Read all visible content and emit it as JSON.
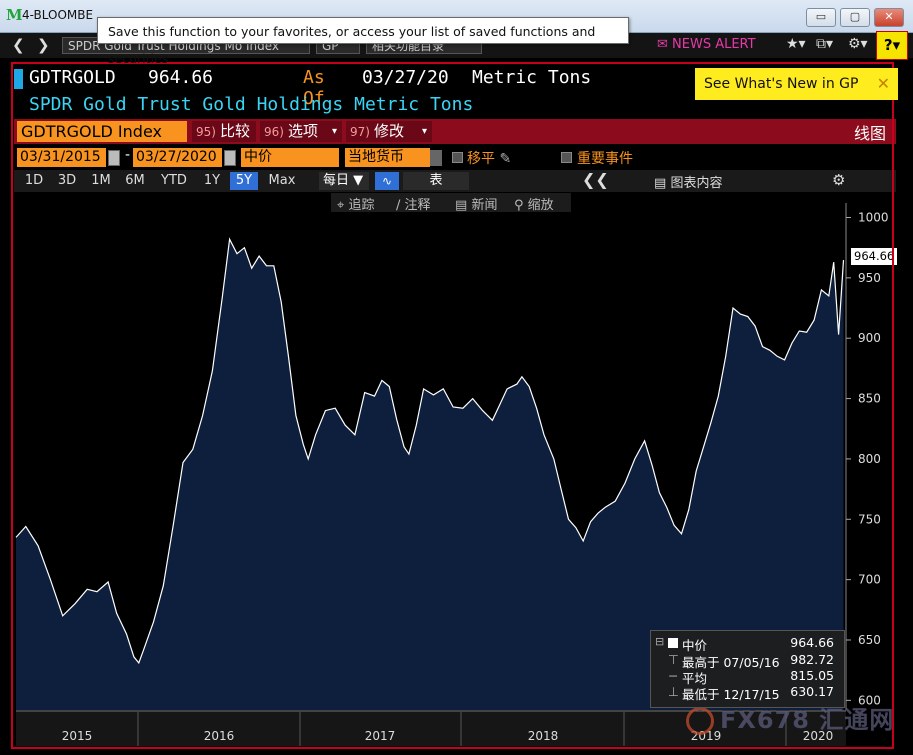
{
  "window": {
    "title": "4-BLOOMBE",
    "minimize": "▭",
    "maximize": "▢",
    "close": "✕"
  },
  "tooltip": "Save this function to your favorites, or access your list of saved functions and securities",
  "toolbar": {
    "security_field": "SPDR Gold Trust Holdings Mo Index",
    "function_field": "GP",
    "related_field": "相关功能目录",
    "news_alert": "NEWS ALERT",
    "help": "?"
  },
  "header": {
    "ticker": "GDTRGOLD",
    "price": "964.66",
    "as_of_label": "As Of",
    "as_of_date": "03/27/20",
    "units": "Metric Tons",
    "subtitle": "SPDR Gold Trust Gold Holdings Metric Tons",
    "whats_new": "See What's New in GP"
  },
  "function_bar": {
    "security": "GDTRGOLD Index",
    "menus": [
      {
        "num": "95)",
        "label": "比较"
      },
      {
        "num": "96)",
        "label": "选项"
      },
      {
        "num": "97)",
        "label": "修改"
      }
    ],
    "chart_type": "线图"
  },
  "controls": {
    "start_date": "03/31/2015",
    "end_date": "03/27/2020",
    "price_type": "中价",
    "currency": "当地货币",
    "flat_label": "移平",
    "events_label": "重要事件"
  },
  "periods": [
    "1D",
    "3D",
    "1M",
    "6M",
    "YTD",
    "1Y",
    "5Y",
    "Max"
  ],
  "active_period": "5Y",
  "frequency": "每日 ▼",
  "table_label": "表",
  "chart_content_label": "图表内容",
  "tools": [
    "追踪",
    "注释",
    "新闻",
    "缩放"
  ],
  "chart_data": {
    "type": "area",
    "title": "",
    "xlabel": "",
    "ylabel": "",
    "ylim": [
      592,
      1012
    ],
    "yticks": [
      600,
      650,
      700,
      750,
      800,
      850,
      900,
      950,
      1000
    ],
    "xticks": [
      "2015",
      "2016",
      "2017",
      "2018",
      "2019",
      "2020"
    ],
    "x_start": "2015-03-31",
    "x_end": "2020-03-27",
    "series": [
      {
        "values": [
          [
            0.0,
            735
          ],
          [
            0.08,
            744
          ],
          [
            0.18,
            728
          ],
          [
            0.28,
            700
          ],
          [
            0.38,
            670
          ],
          [
            0.48,
            680
          ],
          [
            0.58,
            692
          ],
          [
            0.66,
            690
          ],
          [
            0.75,
            698
          ],
          [
            0.82,
            672
          ],
          [
            0.9,
            655
          ],
          [
            0.96,
            636
          ],
          [
            1.0,
            631
          ],
          [
            1.04,
            642
          ],
          [
            1.12,
            665
          ],
          [
            1.2,
            695
          ],
          [
            1.28,
            745
          ],
          [
            1.36,
            797
          ],
          [
            1.44,
            808
          ],
          [
            1.52,
            836
          ],
          [
            1.6,
            873
          ],
          [
            1.68,
            934
          ],
          [
            1.74,
            982
          ],
          [
            1.8,
            970
          ],
          [
            1.86,
            975
          ],
          [
            1.92,
            958
          ],
          [
            1.98,
            968
          ],
          [
            2.04,
            960
          ],
          [
            2.1,
            960
          ],
          [
            2.16,
            930
          ],
          [
            2.22,
            884
          ],
          [
            2.28,
            836
          ],
          [
            2.34,
            812
          ],
          [
            2.38,
            800
          ],
          [
            2.44,
            820
          ],
          [
            2.52,
            840
          ],
          [
            2.6,
            842
          ],
          [
            2.68,
            828
          ],
          [
            2.76,
            820
          ],
          [
            2.84,
            855
          ],
          [
            2.92,
            852
          ],
          [
            2.98,
            865
          ],
          [
            3.04,
            860
          ],
          [
            3.1,
            833
          ],
          [
            3.16,
            810
          ],
          [
            3.2,
            804
          ],
          [
            3.26,
            828
          ],
          [
            3.32,
            858
          ],
          [
            3.4,
            853
          ],
          [
            3.48,
            858
          ],
          [
            3.56,
            843
          ],
          [
            3.64,
            842
          ],
          [
            3.72,
            850
          ],
          [
            3.8,
            840
          ],
          [
            3.88,
            832
          ],
          [
            3.94,
            845
          ],
          [
            4.0,
            858
          ],
          [
            4.08,
            862
          ],
          [
            4.12,
            868
          ],
          [
            4.18,
            860
          ],
          [
            4.24,
            842
          ],
          [
            4.3,
            820
          ],
          [
            4.38,
            800
          ],
          [
            4.44,
            775
          ],
          [
            4.5,
            750
          ],
          [
            4.56,
            743
          ],
          [
            4.62,
            732
          ],
          [
            4.68,
            748
          ],
          [
            4.74,
            755
          ],
          [
            4.8,
            760
          ],
          [
            4.88,
            765
          ],
          [
            4.96,
            780
          ],
          [
            5.04,
            800
          ],
          [
            5.12,
            815
          ],
          [
            5.18,
            795
          ],
          [
            5.24,
            772
          ],
          [
            5.3,
            760
          ],
          [
            5.36,
            745
          ],
          [
            5.42,
            738
          ],
          [
            5.48,
            758
          ],
          [
            5.54,
            790
          ],
          [
            5.6,
            810
          ],
          [
            5.66,
            830
          ],
          [
            5.72,
            852
          ],
          [
            5.78,
            885
          ],
          [
            5.84,
            925
          ],
          [
            5.9,
            920
          ],
          [
            5.96,
            918
          ],
          [
            6.02,
            910
          ],
          [
            6.08,
            893
          ],
          [
            6.14,
            890
          ],
          [
            6.2,
            885
          ],
          [
            6.26,
            882
          ],
          [
            6.32,
            896
          ],
          [
            6.38,
            906
          ],
          [
            6.44,
            905
          ],
          [
            6.5,
            915
          ],
          [
            6.56,
            940
          ],
          [
            6.62,
            935
          ],
          [
            6.66,
            963
          ],
          [
            6.7,
            903
          ],
          [
            6.74,
            964.66
          ]
        ]
      }
    ],
    "last_value_label": "964.66"
  },
  "legend": {
    "series_label": "中价",
    "series_value": "964.66",
    "high_label": "最高于 07/05/16",
    "high_value": "982.72",
    "avg_label": "平均",
    "avg_value": "815.05",
    "low_label": "最低于 12/17/15",
    "low_value": "630.17"
  },
  "watermark": "FX678 汇通网"
}
